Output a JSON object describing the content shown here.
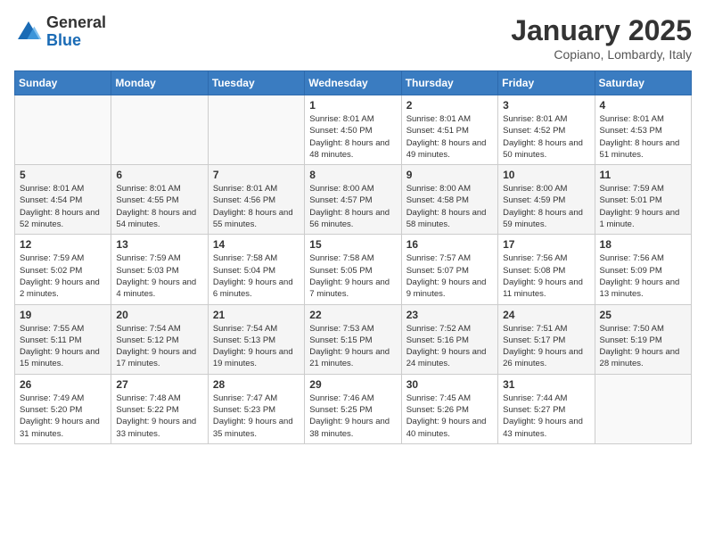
{
  "header": {
    "logo_general": "General",
    "logo_blue": "Blue",
    "month_title": "January 2025",
    "location": "Copiano, Lombardy, Italy"
  },
  "weekdays": [
    "Sunday",
    "Monday",
    "Tuesday",
    "Wednesday",
    "Thursday",
    "Friday",
    "Saturday"
  ],
  "weeks": [
    [
      {
        "day": "",
        "sunrise": "",
        "sunset": "",
        "daylight": ""
      },
      {
        "day": "",
        "sunrise": "",
        "sunset": "",
        "daylight": ""
      },
      {
        "day": "",
        "sunrise": "",
        "sunset": "",
        "daylight": ""
      },
      {
        "day": "1",
        "sunrise": "Sunrise: 8:01 AM",
        "sunset": "Sunset: 4:50 PM",
        "daylight": "Daylight: 8 hours and 48 minutes."
      },
      {
        "day": "2",
        "sunrise": "Sunrise: 8:01 AM",
        "sunset": "Sunset: 4:51 PM",
        "daylight": "Daylight: 8 hours and 49 minutes."
      },
      {
        "day": "3",
        "sunrise": "Sunrise: 8:01 AM",
        "sunset": "Sunset: 4:52 PM",
        "daylight": "Daylight: 8 hours and 50 minutes."
      },
      {
        "day": "4",
        "sunrise": "Sunrise: 8:01 AM",
        "sunset": "Sunset: 4:53 PM",
        "daylight": "Daylight: 8 hours and 51 minutes."
      }
    ],
    [
      {
        "day": "5",
        "sunrise": "Sunrise: 8:01 AM",
        "sunset": "Sunset: 4:54 PM",
        "daylight": "Daylight: 8 hours and 52 minutes."
      },
      {
        "day": "6",
        "sunrise": "Sunrise: 8:01 AM",
        "sunset": "Sunset: 4:55 PM",
        "daylight": "Daylight: 8 hours and 54 minutes."
      },
      {
        "day": "7",
        "sunrise": "Sunrise: 8:01 AM",
        "sunset": "Sunset: 4:56 PM",
        "daylight": "Daylight: 8 hours and 55 minutes."
      },
      {
        "day": "8",
        "sunrise": "Sunrise: 8:00 AM",
        "sunset": "Sunset: 4:57 PM",
        "daylight": "Daylight: 8 hours and 56 minutes."
      },
      {
        "day": "9",
        "sunrise": "Sunrise: 8:00 AM",
        "sunset": "Sunset: 4:58 PM",
        "daylight": "Daylight: 8 hours and 58 minutes."
      },
      {
        "day": "10",
        "sunrise": "Sunrise: 8:00 AM",
        "sunset": "Sunset: 4:59 PM",
        "daylight": "Daylight: 8 hours and 59 minutes."
      },
      {
        "day": "11",
        "sunrise": "Sunrise: 7:59 AM",
        "sunset": "Sunset: 5:01 PM",
        "daylight": "Daylight: 9 hours and 1 minute."
      }
    ],
    [
      {
        "day": "12",
        "sunrise": "Sunrise: 7:59 AM",
        "sunset": "Sunset: 5:02 PM",
        "daylight": "Daylight: 9 hours and 2 minutes."
      },
      {
        "day": "13",
        "sunrise": "Sunrise: 7:59 AM",
        "sunset": "Sunset: 5:03 PM",
        "daylight": "Daylight: 9 hours and 4 minutes."
      },
      {
        "day": "14",
        "sunrise": "Sunrise: 7:58 AM",
        "sunset": "Sunset: 5:04 PM",
        "daylight": "Daylight: 9 hours and 6 minutes."
      },
      {
        "day": "15",
        "sunrise": "Sunrise: 7:58 AM",
        "sunset": "Sunset: 5:05 PM",
        "daylight": "Daylight: 9 hours and 7 minutes."
      },
      {
        "day": "16",
        "sunrise": "Sunrise: 7:57 AM",
        "sunset": "Sunset: 5:07 PM",
        "daylight": "Daylight: 9 hours and 9 minutes."
      },
      {
        "day": "17",
        "sunrise": "Sunrise: 7:56 AM",
        "sunset": "Sunset: 5:08 PM",
        "daylight": "Daylight: 9 hours and 11 minutes."
      },
      {
        "day": "18",
        "sunrise": "Sunrise: 7:56 AM",
        "sunset": "Sunset: 5:09 PM",
        "daylight": "Daylight: 9 hours and 13 minutes."
      }
    ],
    [
      {
        "day": "19",
        "sunrise": "Sunrise: 7:55 AM",
        "sunset": "Sunset: 5:11 PM",
        "daylight": "Daylight: 9 hours and 15 minutes."
      },
      {
        "day": "20",
        "sunrise": "Sunrise: 7:54 AM",
        "sunset": "Sunset: 5:12 PM",
        "daylight": "Daylight: 9 hours and 17 minutes."
      },
      {
        "day": "21",
        "sunrise": "Sunrise: 7:54 AM",
        "sunset": "Sunset: 5:13 PM",
        "daylight": "Daylight: 9 hours and 19 minutes."
      },
      {
        "day": "22",
        "sunrise": "Sunrise: 7:53 AM",
        "sunset": "Sunset: 5:15 PM",
        "daylight": "Daylight: 9 hours and 21 minutes."
      },
      {
        "day": "23",
        "sunrise": "Sunrise: 7:52 AM",
        "sunset": "Sunset: 5:16 PM",
        "daylight": "Daylight: 9 hours and 24 minutes."
      },
      {
        "day": "24",
        "sunrise": "Sunrise: 7:51 AM",
        "sunset": "Sunset: 5:17 PM",
        "daylight": "Daylight: 9 hours and 26 minutes."
      },
      {
        "day": "25",
        "sunrise": "Sunrise: 7:50 AM",
        "sunset": "Sunset: 5:19 PM",
        "daylight": "Daylight: 9 hours and 28 minutes."
      }
    ],
    [
      {
        "day": "26",
        "sunrise": "Sunrise: 7:49 AM",
        "sunset": "Sunset: 5:20 PM",
        "daylight": "Daylight: 9 hours and 31 minutes."
      },
      {
        "day": "27",
        "sunrise": "Sunrise: 7:48 AM",
        "sunset": "Sunset: 5:22 PM",
        "daylight": "Daylight: 9 hours and 33 minutes."
      },
      {
        "day": "28",
        "sunrise": "Sunrise: 7:47 AM",
        "sunset": "Sunset: 5:23 PM",
        "daylight": "Daylight: 9 hours and 35 minutes."
      },
      {
        "day": "29",
        "sunrise": "Sunrise: 7:46 AM",
        "sunset": "Sunset: 5:25 PM",
        "daylight": "Daylight: 9 hours and 38 minutes."
      },
      {
        "day": "30",
        "sunrise": "Sunrise: 7:45 AM",
        "sunset": "Sunset: 5:26 PM",
        "daylight": "Daylight: 9 hours and 40 minutes."
      },
      {
        "day": "31",
        "sunrise": "Sunrise: 7:44 AM",
        "sunset": "Sunset: 5:27 PM",
        "daylight": "Daylight: 9 hours and 43 minutes."
      },
      {
        "day": "",
        "sunrise": "",
        "sunset": "",
        "daylight": ""
      }
    ]
  ]
}
